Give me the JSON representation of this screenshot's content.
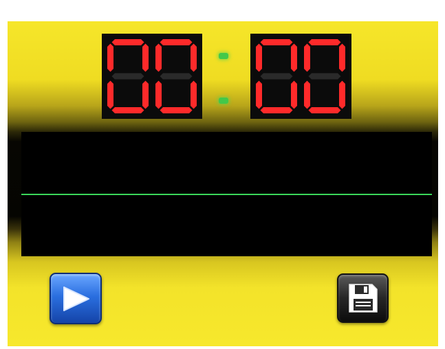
{
  "clock": {
    "minutes": "00",
    "seconds": "00",
    "segment_on_color": "#ff2a2a",
    "segment_off_color": "#2a2a2a",
    "colon_color": "#44c84a"
  },
  "scope": {
    "background": "#000000",
    "trace_color": "#3bd65a"
  },
  "buttons": {
    "play_icon": "play-icon",
    "save_icon": "floppy-disk-icon"
  },
  "colors": {
    "panel": "#f3e32a",
    "play_button": "#2a6fe0",
    "save_button": "#262626"
  }
}
